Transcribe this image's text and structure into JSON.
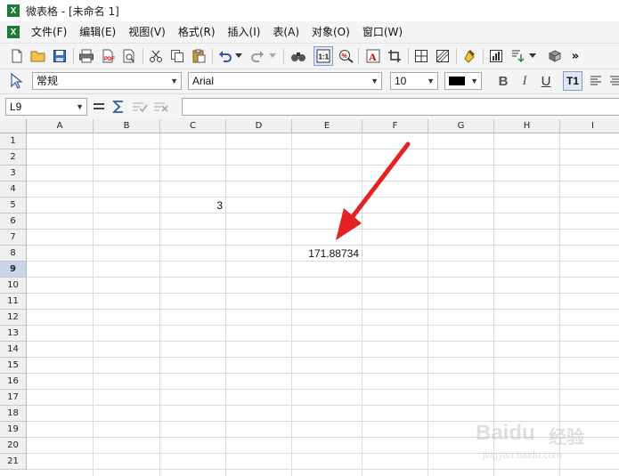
{
  "window": {
    "title": "微表格 - [未命名 1]"
  },
  "menu": [
    "文件(F)",
    "编辑(E)",
    "视图(V)",
    "格式(R)",
    "插入(I)",
    "表(A)",
    "对象(O)",
    "窗口(W)"
  ],
  "toolbar_more": "»",
  "format": {
    "style": "常规",
    "font": "Arial",
    "size": "10",
    "bold": "B",
    "italic": "I",
    "underline": "U",
    "text_btn": "T1"
  },
  "formula": {
    "cell_ref": "L9",
    "value": ""
  },
  "sheet": {
    "columns": [
      "A",
      "B",
      "C",
      "D",
      "E",
      "F",
      "G",
      "H",
      "I"
    ],
    "rows": [
      "1",
      "2",
      "3",
      "4",
      "5",
      "6",
      "7",
      "8",
      "9",
      "10",
      "11",
      "12",
      "13",
      "14",
      "15",
      "16",
      "17",
      "18",
      "19",
      "20",
      "21"
    ],
    "active_row": "9",
    "cells": {
      "D5": "3",
      "E8": "171.88734"
    }
  },
  "watermark": {
    "brand": "Baidu",
    "sub": "经验",
    "url": "jingyan.baidu.com"
  },
  "colors": {
    "arrow": "#e52222",
    "accent": "#1f7a3a"
  }
}
